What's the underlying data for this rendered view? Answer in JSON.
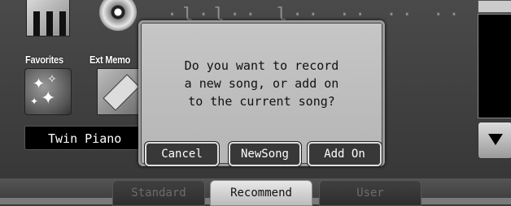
{
  "background": {
    "hidden_text": "·l·l·· l·· ·· ·· ·· ·· ··   2"
  },
  "icons": {
    "favorites_label": "Favorites",
    "ext_memory_label": "Ext Memo"
  },
  "tone_display": "Twin Piano",
  "dialog": {
    "message": "Do you want to record\na new song, or add on\nto the current song?",
    "buttons": [
      "Cancel",
      "NewSong",
      "Add On"
    ]
  },
  "tabs": [
    "Standard",
    "Recommend",
    "User"
  ],
  "active_tab": "Recommend",
  "colors": {
    "dialog_bg": "#c0c0c0",
    "button_bg": "#383838",
    "active_tab": "#d8d8d8"
  }
}
